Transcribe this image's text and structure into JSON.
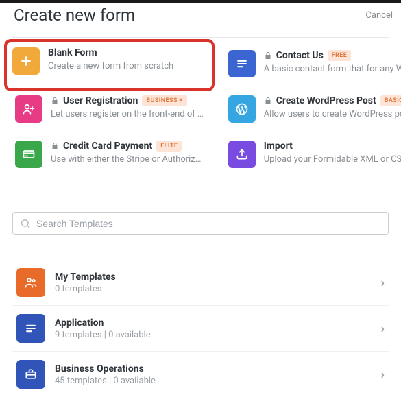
{
  "header": {
    "title": "Create new form",
    "cancel": "Cancel"
  },
  "tiles": [
    {
      "title": "Blank Form",
      "desc": "Create a new form from scratch",
      "locked": false,
      "badge": "",
      "highlight": true
    },
    {
      "title": "Contact Us",
      "desc": "A basic contact form that for any Wor…",
      "locked": true,
      "badge": "FREE"
    },
    {
      "title": "User Registration",
      "desc": "Let users register on the front-end of …",
      "locked": true,
      "badge": "BUSINESS +"
    },
    {
      "title": "Create WordPress Post",
      "desc": "Allow users to create WordPress post…",
      "locked": true,
      "badge": "BASIC +"
    },
    {
      "title": "Credit Card Payment",
      "desc": "Use with either the Stripe or Authoriz…",
      "locked": true,
      "badge": "ELITE"
    },
    {
      "title": "Import",
      "desc": "Upload your Formidable XML or CSV …",
      "locked": false,
      "badge": ""
    }
  ],
  "search": {
    "placeholder": "Search Templates"
  },
  "categories": [
    {
      "title": "My Templates",
      "meta": "0 templates"
    },
    {
      "title": "Application",
      "meta": "9 templates  |  0 available"
    },
    {
      "title": "Business Operations",
      "meta": "45 templates  |  0 available"
    }
  ]
}
